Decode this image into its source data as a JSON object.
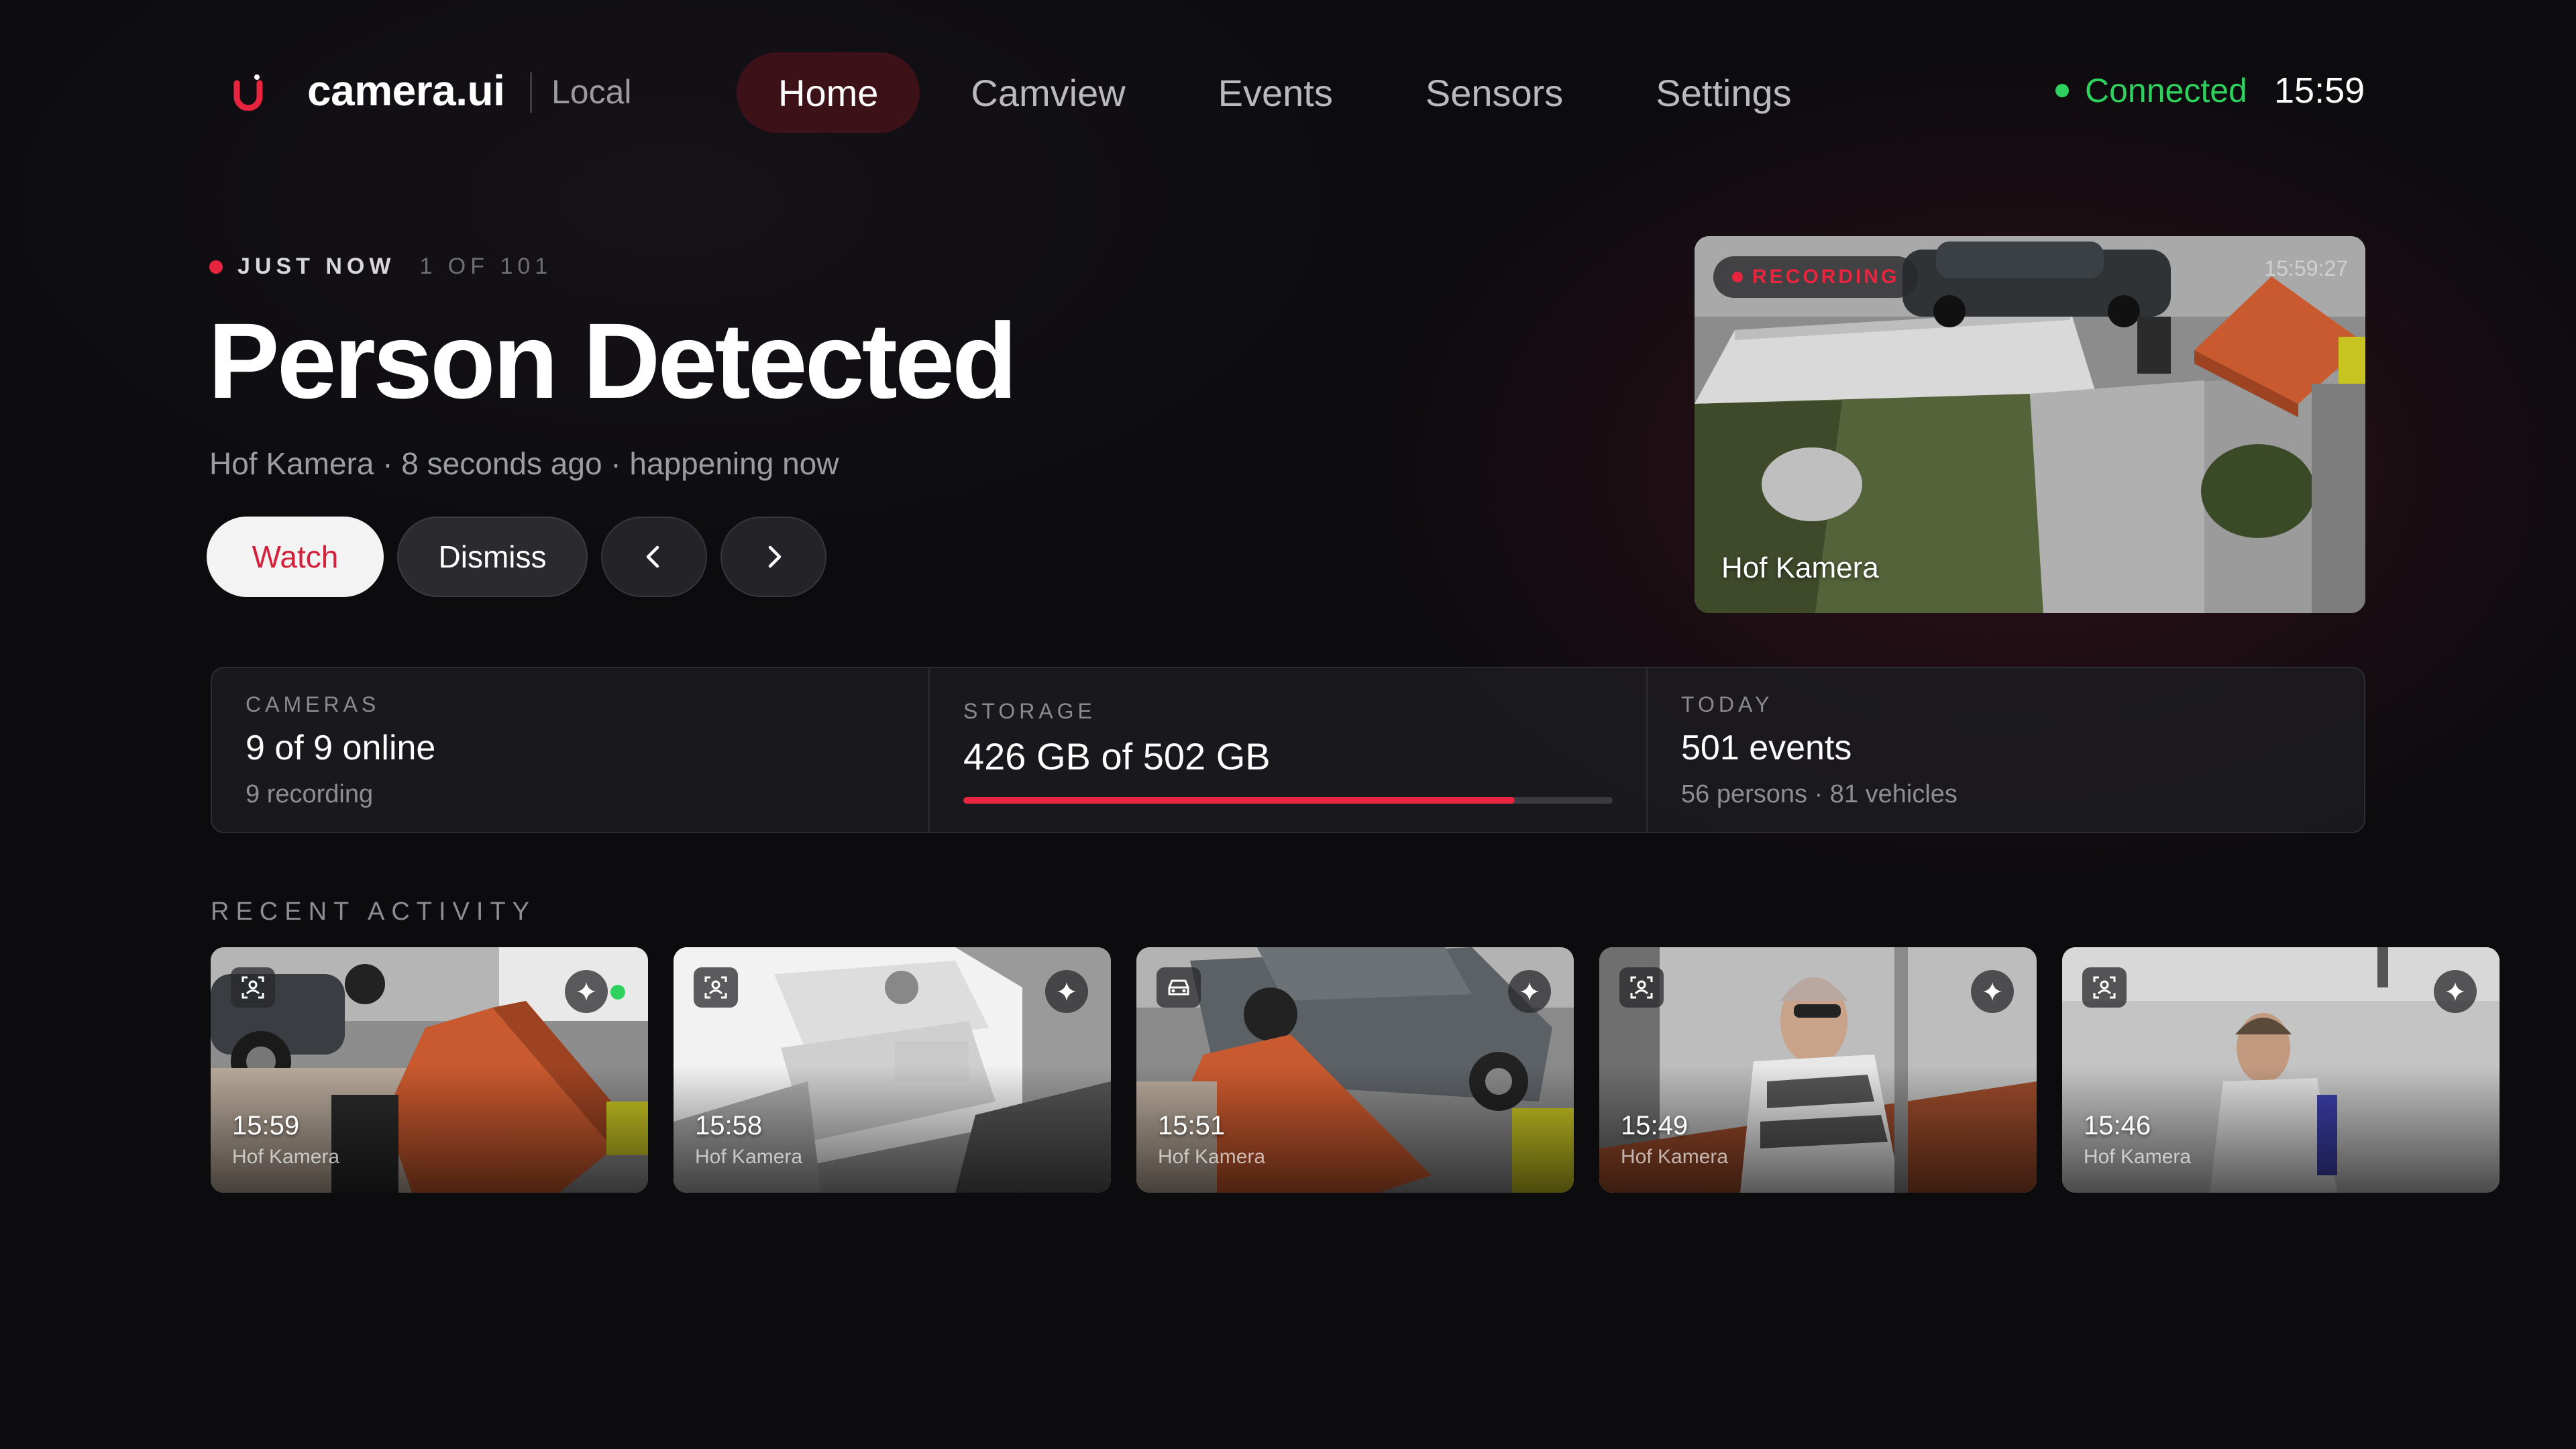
{
  "header": {
    "brand": "camera.ui",
    "brand_sub": "Local",
    "nav": [
      {
        "label": "Home",
        "active": true
      },
      {
        "label": "Camview",
        "active": false
      },
      {
        "label": "Events",
        "active": false
      },
      {
        "label": "Sensors",
        "active": false
      },
      {
        "label": "Settings",
        "active": false
      }
    ],
    "status": "Connected",
    "clock": "15:59"
  },
  "hero": {
    "eyebrow_when": "JUST NOW",
    "eyebrow_count": "1 OF 101",
    "title": "Person Detected",
    "subtitle": "Hof Kamera · 8 seconds ago · happening now",
    "watch_label": "Watch",
    "dismiss_label": "Dismiss",
    "prev_icon": "chevron-left-icon",
    "next_icon": "chevron-right-icon"
  },
  "preview": {
    "badge": "RECORDING",
    "timestamp": "15:59:27",
    "camera": "Hof Kamera"
  },
  "stats": {
    "cameras": {
      "label": "CAMERAS",
      "value": "9 of 9 online",
      "sub": "9 recording"
    },
    "storage": {
      "label": "STORAGE",
      "value": "426 GB of 502 GB",
      "used_fraction": 0.849
    },
    "today": {
      "label": "TODAY",
      "value": "501 events",
      "sub": "56 persons · 81 vehicles"
    }
  },
  "recent": {
    "title": "RECENT ACTIVITY",
    "items": [
      {
        "time": "15:59",
        "camera": "Hof Kamera",
        "type_icon": "person-focus-icon",
        "live": true
      },
      {
        "time": "15:58",
        "camera": "Hof Kamera",
        "type_icon": "person-focus-icon",
        "live": false
      },
      {
        "time": "15:51",
        "camera": "Hof Kamera",
        "type_icon": "car-icon",
        "live": false
      },
      {
        "time": "15:49",
        "camera": "Hof Kamera",
        "type_icon": "person-focus-icon",
        "live": false
      },
      {
        "time": "15:46",
        "camera": "Hof Kamera",
        "type_icon": "person-focus-icon",
        "live": false
      }
    ]
  },
  "colors": {
    "accent": "#e8243f",
    "connected": "#2fd15e",
    "background": "#0c0c0f"
  }
}
